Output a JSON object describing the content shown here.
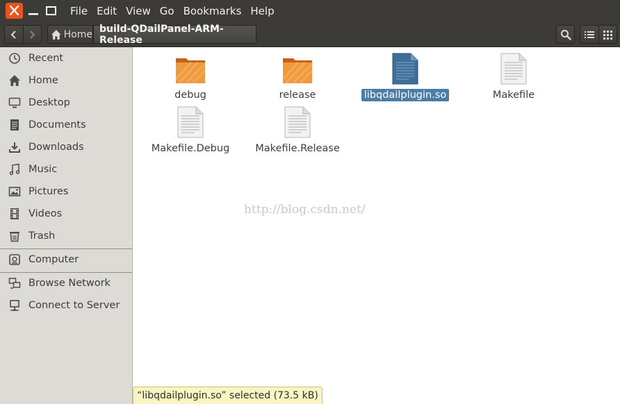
{
  "colors": {
    "accent": "#e8531e",
    "selection": "#4a7ea8",
    "sidebar_bg": "#dcdbd6",
    "toolbar_bg": "#3c3b37",
    "status_bg": "#f8f5c2"
  },
  "menu": {
    "items": [
      {
        "label": "File"
      },
      {
        "label": "Edit"
      },
      {
        "label": "View"
      },
      {
        "label": "Go"
      },
      {
        "label": "Bookmarks"
      },
      {
        "label": "Help"
      }
    ]
  },
  "breadcrumb": {
    "home_label": "Home",
    "current": "build-QDailPanel-ARM-Release"
  },
  "sidebar": {
    "items": [
      {
        "label": "Recent",
        "icon": "clock-icon"
      },
      {
        "label": "Home",
        "icon": "home-icon"
      },
      {
        "label": "Desktop",
        "icon": "desktop-icon"
      },
      {
        "label": "Documents",
        "icon": "document-icon"
      },
      {
        "label": "Downloads",
        "icon": "download-icon"
      },
      {
        "label": "Music",
        "icon": "music-icon"
      },
      {
        "label": "Pictures",
        "icon": "picture-icon"
      },
      {
        "label": "Videos",
        "icon": "film-icon"
      },
      {
        "label": "Trash",
        "icon": "trash-icon"
      },
      {
        "label": "Computer",
        "icon": "harddisk-icon"
      },
      {
        "label": "Browse Network",
        "icon": "network-icon"
      },
      {
        "label": "Connect to Server",
        "icon": "server-icon"
      }
    ]
  },
  "files": [
    {
      "name": "debug",
      "type": "folder",
      "selected": false
    },
    {
      "name": "release",
      "type": "folder",
      "selected": false
    },
    {
      "name": "libqdailplugin.so",
      "type": "library",
      "selected": true
    },
    {
      "name": "Makefile",
      "type": "text",
      "selected": false
    },
    {
      "name": "Makefile.Debug",
      "type": "text",
      "selected": false
    },
    {
      "name": "Makefile.Release",
      "type": "text",
      "selected": false
    }
  ],
  "watermark": "http://blog.csdn.net/",
  "status": {
    "text": "“libqdailplugin.so” selected  (73.5 kB)"
  }
}
